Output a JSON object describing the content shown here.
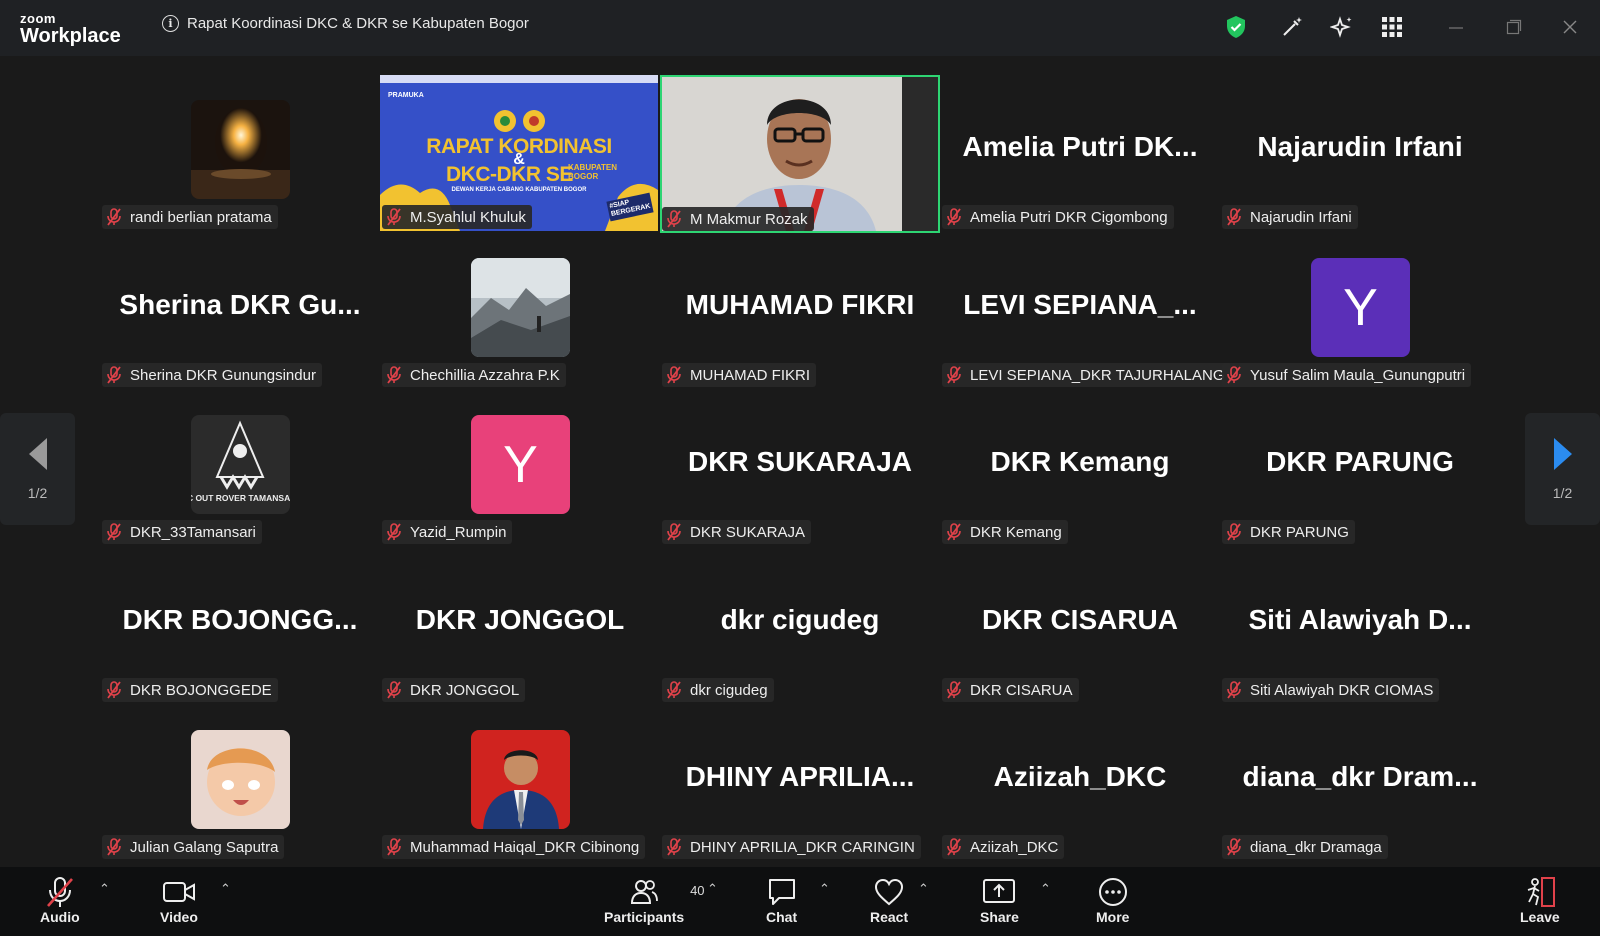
{
  "app": {
    "logo_top": "zoom",
    "logo_bottom": "Workplace"
  },
  "meeting": {
    "title": "Rapat Koordinasi DKC & DKR se Kabupaten Bogor"
  },
  "titlebar_icons": [
    "shield-check-icon",
    "magic-wand-icon",
    "sparkle-icon",
    "apps-grid-icon",
    "minimize-icon",
    "maximize-icon",
    "close-icon"
  ],
  "tiles": [
    {
      "name": "randi berlian pratama",
      "kind": "photo",
      "photo": "fire"
    },
    {
      "name": "M.Syahlul Khuluk",
      "kind": "shared-screen"
    },
    {
      "name": "M Makmur Rozak",
      "kind": "camera",
      "active": true
    },
    {
      "name": "Amelia Putri DKR Cigombong",
      "kind": "text",
      "display": "Amelia  Putri  DK..."
    },
    {
      "name": "Najarudin Irfani",
      "kind": "text",
      "display": "Najarudin Irfani"
    },
    {
      "name": "Sherina DKR Gunungsindur",
      "kind": "text",
      "display": "Sherina  DKR  Gu..."
    },
    {
      "name": "Chechillia Azzahra P.K",
      "kind": "photo",
      "photo": "mountain"
    },
    {
      "name": "MUHAMAD FIKRI",
      "kind": "text",
      "display": "MUHAMAD FIKRI"
    },
    {
      "name": "LEVI SEPIANA_DKR TAJURHALANG",
      "kind": "text",
      "display": "LEVI  SEPIANA_..."
    },
    {
      "name": "Yusuf Salim Maula_Gunungputri",
      "kind": "letter",
      "letter": "Y",
      "color": "#5b2fb8"
    },
    {
      "name": "DKR_33Tamansari",
      "kind": "photo",
      "photo": "scout-logo",
      "caption": "SC OUT ROVER TAMANSARI"
    },
    {
      "name": "Yazid_Rumpin",
      "kind": "letter",
      "letter": "Y",
      "color": "#e8417a"
    },
    {
      "name": "DKR SUKARAJA",
      "kind": "text",
      "display": "DKR SUKARAJA"
    },
    {
      "name": "DKR Kemang",
      "kind": "text",
      "display": "DKR Kemang"
    },
    {
      "name": "DKR PARUNG",
      "kind": "text",
      "display": "DKR PARUNG"
    },
    {
      "name": "DKR BOJONGGEDE",
      "kind": "text",
      "display": "DKR  BOJONGG..."
    },
    {
      "name": "DKR JONGGOL",
      "kind": "text",
      "display": "DKR JONGGOL"
    },
    {
      "name": "dkr cigudeg",
      "kind": "text",
      "display": "dkr cigudeg"
    },
    {
      "name": "DKR CISARUA",
      "kind": "text",
      "display": "DKR CISARUA"
    },
    {
      "name": "Siti Alawiyah DKR CIOMAS",
      "kind": "text",
      "display": "Siti  Alawiyah  D..."
    },
    {
      "name": "Julian Galang Saputra",
      "kind": "photo",
      "photo": "anime"
    },
    {
      "name": "Muhammad Haiqal_DKR Cibinong",
      "kind": "photo",
      "photo": "portrait-red"
    },
    {
      "name": "DHINY APRILIA_DKR CARINGIN",
      "kind": "text",
      "display": "DHINY  APRILIA..."
    },
    {
      "name": "Aziizah_DKC",
      "kind": "text",
      "display": "Aziizah_DKC"
    },
    {
      "name": "diana_dkr Dramaga",
      "kind": "text",
      "display": "diana_dkr  Dram..."
    }
  ],
  "shared_screen": {
    "brand": "PRAMUKA",
    "headline1": "RAPAT KORDINASI",
    "amp": "&",
    "headline2": "DKC-DKR SE",
    "headline2b": "KABUPATEN BOGOR",
    "subline": "DEWAN KERJA CABANG KABUPATEN BOGOR",
    "badge": "#SIAP BERGERAK"
  },
  "pager": {
    "left": "1/2",
    "right": "1/2"
  },
  "toolbar": {
    "audio": "Audio",
    "video": "Video",
    "participants": "Participants",
    "participants_count": "40",
    "chat": "Chat",
    "react": "React",
    "share": "Share",
    "more": "More",
    "leave": "Leave"
  },
  "colors": {
    "active_speaker": "#2ed573",
    "muted": "#e0424a",
    "pager_arrow_right": "#2b8cf0"
  }
}
